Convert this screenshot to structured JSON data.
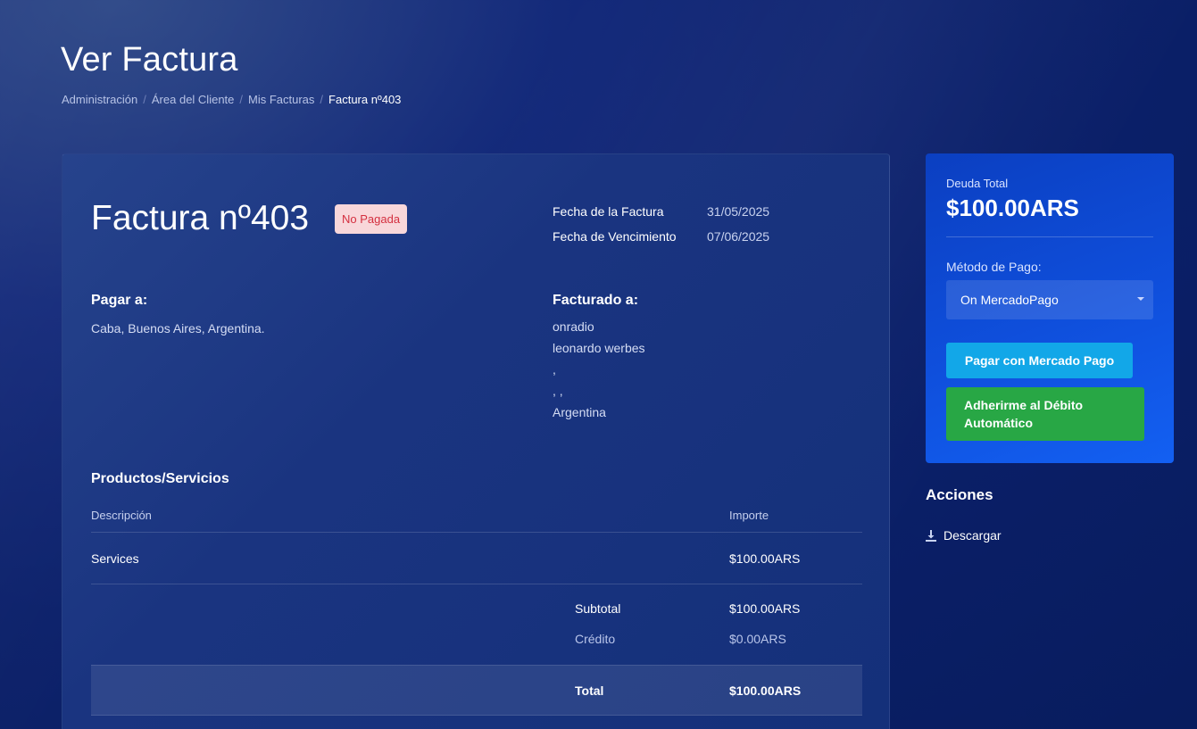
{
  "header": {
    "title": "Ver Factura",
    "breadcrumb": [
      "Administración",
      "Área del Cliente",
      "Mis Facturas",
      "Factura nº403"
    ]
  },
  "invoice": {
    "title": "Factura nº403",
    "status": "No Pagada",
    "dates": [
      {
        "label": "Fecha de la Factura",
        "value": "31/05/2025"
      },
      {
        "label": "Fecha de Vencimiento",
        "value": "07/06/2025"
      }
    ],
    "pay_to": {
      "heading": "Pagar a:",
      "address": "Caba, Buenos Aires, Argentina."
    },
    "billed_to": {
      "heading": "Facturado a:",
      "lines": [
        "onradio",
        "leonardo werbes",
        ",",
        ", ,",
        "Argentina"
      ]
    },
    "products": {
      "heading": "Productos/Servicios",
      "columns": [
        "Descripción",
        "Importe"
      ],
      "rows": [
        {
          "description": "Services",
          "amount": "$100.00ARS"
        }
      ],
      "subtotal_label": "Subtotal",
      "subtotal_value": "$100.00ARS",
      "credit_label": "Crédito",
      "credit_value": "$0.00ARS",
      "total_label": "Total",
      "total_value": "$100.00ARS"
    }
  },
  "sidebar": {
    "debt_label": "Deuda Total",
    "debt_value": "$100.00ARS",
    "method_label": "Método de Pago:",
    "method_selected": "On MercadoPago",
    "pay_button": "Pagar con Mercado Pago",
    "debit_button": "Adherirme al Débito Automático",
    "actions_heading": "Acciones",
    "download_label": "Descargar",
    "download_icon": "download-icon"
  },
  "colors": {
    "status_badge_bg": "#f8d7da",
    "status_badge_text": "#d42f3f",
    "pay_button": "#12a7e8",
    "debit_button": "#28a745",
    "side_card": "#0f4fdc"
  }
}
